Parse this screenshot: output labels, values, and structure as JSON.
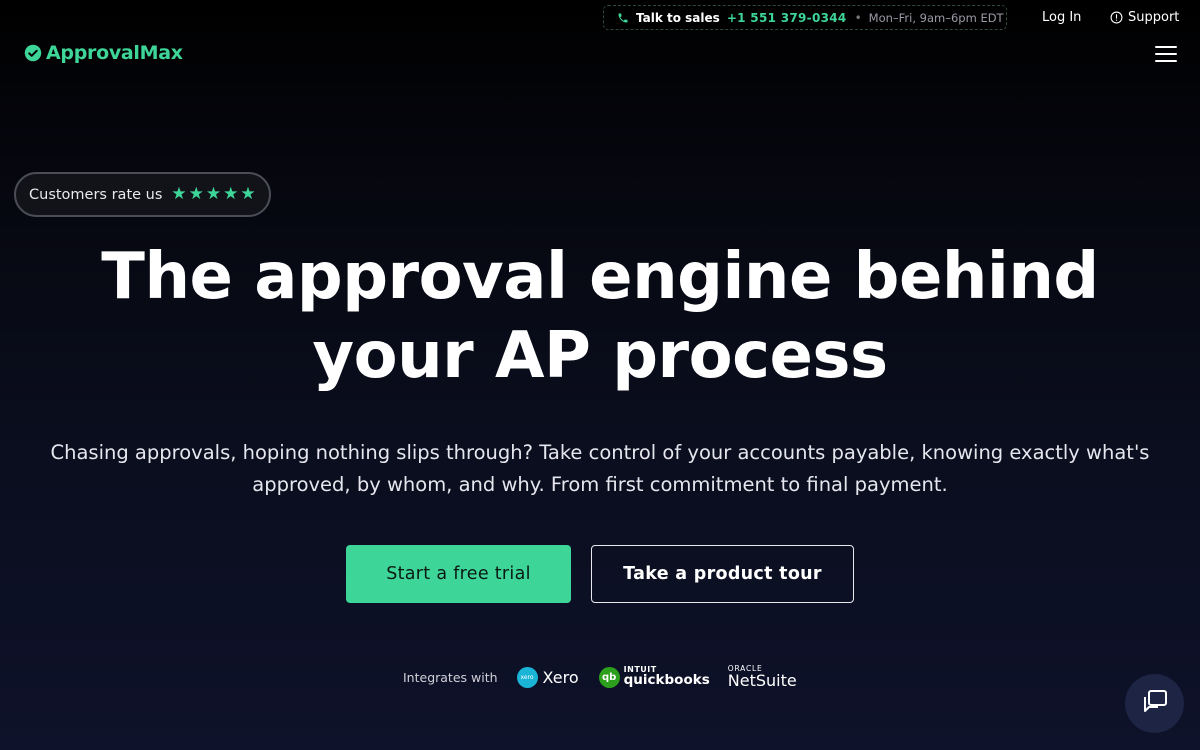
{
  "topbar": {
    "talk_label": "Talk to sales",
    "phone": "+1 551 379-0344",
    "separator": "•",
    "hours": "Mon–Fri, 9am–6pm EDT",
    "login": "Log In",
    "support": "Support"
  },
  "brand": {
    "name": "ApprovalMax",
    "accent": "#3ed598"
  },
  "rating": {
    "label": "Customers rate us",
    "stars": [
      "★",
      "★",
      "★",
      "★",
      "★"
    ]
  },
  "hero": {
    "headline_line1": "The approval engine behind",
    "headline_line2": "your AP process",
    "subhead_line1": "Chasing approvals, hoping nothing slips through? Take control of your accounts payable, knowing exactly what's",
    "subhead_line2": "approved, by whom, and why. From first commitment to final payment.",
    "primary_cta": "Start a free trial",
    "secondary_cta": "Take a product tour"
  },
  "integrations": {
    "label": "Integrates with",
    "xero_badge": "xero",
    "xero": "Xero",
    "qb_badge": "qb",
    "qb_intuit": "INTUIT",
    "qb_name": "quickbooks",
    "ns_oracle": "ORACLE",
    "ns_name": "NetSuite"
  }
}
